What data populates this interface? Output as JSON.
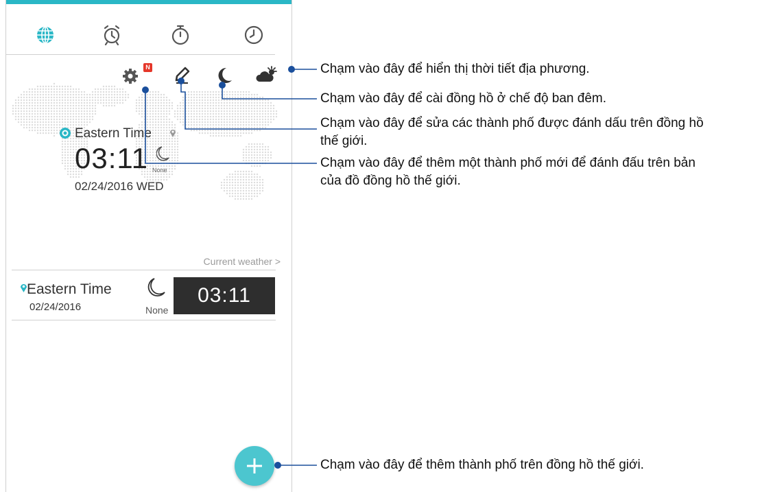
{
  "tabs": [
    {
      "name": "world-clock",
      "icon": "globe-icon",
      "active": true
    },
    {
      "name": "alarm",
      "icon": "alarm-clock-icon",
      "active": false
    },
    {
      "name": "stopwatch",
      "icon": "stopwatch-icon",
      "active": false
    },
    {
      "name": "timer",
      "icon": "timer-icon",
      "active": false
    }
  ],
  "toolbar": {
    "settings_icon": "gear-icon",
    "badge": "N",
    "edit_icon": "pencil-icon",
    "night_mode_icon": "moon-icon",
    "weather_icon": "cloud-sun-icon"
  },
  "highlight": {
    "city": "Eastern Time",
    "time": "03:11",
    "weather": "None",
    "date": "02/24/2016 WED"
  },
  "current_weather_link": "Current weather >",
  "city_list": [
    {
      "city": "Eastern Time",
      "date": "02/24/2016",
      "weather": "None",
      "time": "03:11"
    }
  ],
  "fab_icon": "plus-icon",
  "callouts": {
    "weather": "Chạm vào đây để hiển thị thời tiết địa phương.",
    "night_mode": "Chạm vào đây để cài đồng hồ ở chế độ ban đêm.",
    "edit_line1": "Chạm vào đây để sửa các thành phố được đánh dấu trên đồng hồ",
    "edit_line2": "thế giới.",
    "settings_line1": "Chạm vào đây để thêm một thành phố mới để đánh đấu trên bản",
    "settings_line2": "của đồ đồng hồ thế giới.",
    "add_city": "Chạm vào đây để thêm thành phố trên đồng hồ thế giới."
  },
  "colors": {
    "accent": "#2ab7c6",
    "fab": "#4cc6cf",
    "callout_line": "#1a4f9c",
    "badge": "#e5372a",
    "clock_bg": "#2e2e2e"
  }
}
